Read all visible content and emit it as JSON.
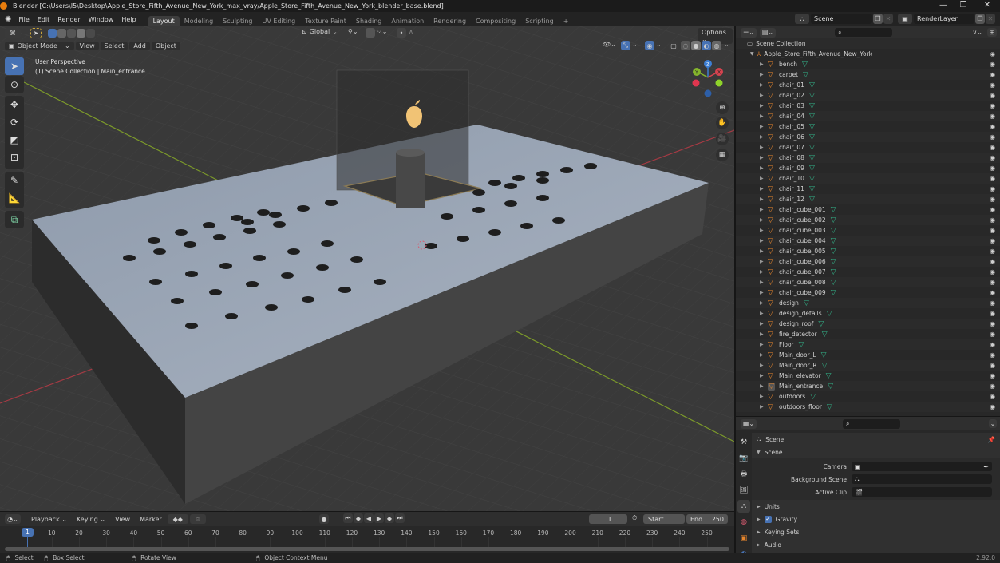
{
  "window": {
    "title": "Blender [C:\\Users\\I5\\Desktop\\Apple_Store_Fifth_Avenue_New_York_max_vray/Apple_Store_Fifth_Avenue_New_York_blender_base.blend]",
    "controls": {
      "minimize": "—",
      "maximize": "❐",
      "close": "✕"
    }
  },
  "menubar": {
    "items": [
      "File",
      "Edit",
      "Render",
      "Window",
      "Help"
    ],
    "workspace_tabs": [
      "Layout",
      "Modeling",
      "Sculpting",
      "UV Editing",
      "Texture Paint",
      "Shading",
      "Animation",
      "Rendering",
      "Compositing",
      "Scripting"
    ],
    "active_tab": "Layout",
    "add_tab": "+",
    "scene": "Scene",
    "view_layer": "RenderLayer"
  },
  "viewport": {
    "editor_type_icon": "3d-view-icon",
    "transform_orientation": "Global",
    "options_label": "Options",
    "mode": "Object Mode",
    "menus": [
      "View",
      "Select",
      "Add",
      "Object"
    ],
    "overlay_line1": "User Perspective",
    "overlay_line2": "(1) Scene Collection | Main_entrance",
    "gizmo_axes": {
      "x": "X",
      "y": "Y",
      "z": "Z"
    },
    "tools": [
      "select-box",
      "cursor",
      "move",
      "rotate",
      "scale",
      "transform",
      "annotate",
      "measure",
      "add-cube"
    ],
    "nav": [
      "zoom",
      "pan",
      "camera",
      "grid"
    ]
  },
  "outliner": {
    "root": "Scene Collection",
    "collection": "Apple_Store_Fifth_Avenue_New_York",
    "search_placeholder": "",
    "items": [
      "bench",
      "carpet",
      "chair_01",
      "chair_02",
      "chair_03",
      "chair_04",
      "chair_05",
      "chair_06",
      "chair_07",
      "chair_08",
      "chair_09",
      "chair_10",
      "chair_11",
      "chair_12",
      "chair_cube_001",
      "chair_cube_002",
      "chair_cube_003",
      "chair_cube_004",
      "chair_cube_005",
      "chair_cube_006",
      "chair_cube_007",
      "chair_cube_008",
      "chair_cube_009",
      "design",
      "design_details",
      "design_roof",
      "fire_detector",
      "Floor",
      "Main_door_L",
      "Main_door_R",
      "Main_elevator",
      "Main_entrance",
      "outdoors",
      "outdoors_floor"
    ],
    "active_item": "Main_entrance"
  },
  "properties": {
    "context": "Scene",
    "panel": "Scene",
    "fields": [
      {
        "label": "Camera",
        "value": ""
      },
      {
        "label": "Background Scene",
        "value": ""
      },
      {
        "label": "Active Clip",
        "value": ""
      }
    ],
    "subpanels": [
      {
        "label": "Units",
        "checkbox": false
      },
      {
        "label": "Gravity",
        "checkbox": true,
        "checked": true
      },
      {
        "label": "Keying Sets",
        "checkbox": false
      },
      {
        "label": "Audio",
        "checkbox": false
      }
    ]
  },
  "timeline": {
    "menus": [
      "Playback",
      "Keying",
      "View",
      "Marker"
    ],
    "current_frame": "1",
    "start_label": "Start",
    "start": "1",
    "end_label": "End",
    "end": "250",
    "ticks": [
      "10",
      "20",
      "30",
      "40",
      "50",
      "60",
      "70",
      "80",
      "90",
      "100",
      "110",
      "120",
      "130",
      "140",
      "150",
      "160",
      "170",
      "180",
      "190",
      "200",
      "210",
      "220",
      "230",
      "240",
      "250"
    ],
    "playhead": "1"
  },
  "statusbar": {
    "select": "Select",
    "box_select": "Box Select",
    "rotate_view": "Rotate View",
    "context_menu": "Object Context Menu",
    "version": "2.92.0"
  },
  "colors": {
    "accent": "#4772b3",
    "mesh_icon": "#e6852c",
    "data_icon": "#33b389",
    "x_axis": "#d5434f",
    "y_axis": "#85b52c",
    "z_axis": "#3d7fd4"
  }
}
